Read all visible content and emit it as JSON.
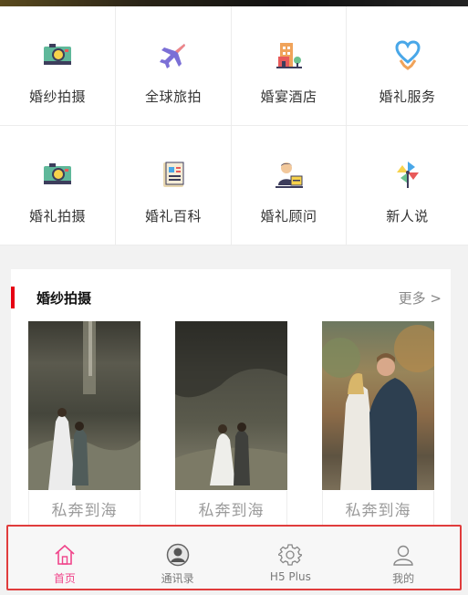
{
  "categories": [
    {
      "label": "婚纱拍摄",
      "icon": "camera-icon"
    },
    {
      "label": "全球旅拍",
      "icon": "airplane-icon"
    },
    {
      "label": "婚宴酒店",
      "icon": "hotel-icon"
    },
    {
      "label": "婚礼服务",
      "icon": "heart-service-icon"
    },
    {
      "label": "婚礼拍摄",
      "icon": "camera-icon"
    },
    {
      "label": "婚礼百科",
      "icon": "book-icon"
    },
    {
      "label": "婚礼顾问",
      "icon": "advisor-icon"
    },
    {
      "label": "新人说",
      "icon": "pinwheel-icon"
    }
  ],
  "section": {
    "title": "婚纱拍摄",
    "more": "更多 >",
    "cards": [
      {
        "caption": "私奔到海"
      },
      {
        "caption": "私奔到海"
      },
      {
        "caption": "私奔到海"
      }
    ]
  },
  "tabbar": {
    "items": [
      {
        "label": "首页",
        "icon": "home-icon",
        "active": true
      },
      {
        "label": "通讯录",
        "icon": "contacts-icon",
        "active": false
      },
      {
        "label": "H5 Plus",
        "icon": "gear-icon",
        "active": false
      },
      {
        "label": "我的",
        "icon": "user-icon",
        "active": false
      }
    ],
    "active_color": "#f0448a"
  },
  "colors": {
    "accent_bar": "#e60012",
    "tab_active": "#f0448a",
    "tabbar_highlight_border": "#e03c3c"
  }
}
